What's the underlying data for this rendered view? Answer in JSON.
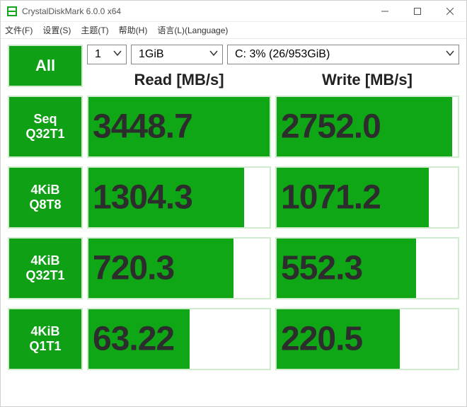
{
  "window": {
    "title": "CrystalDiskMark 6.0.0 x64"
  },
  "menu": {
    "file": "文件(F)",
    "settings": "设置(S)",
    "theme": "主题(T)",
    "help": "帮助(H)",
    "language": "语言(L)(Language)"
  },
  "controls": {
    "all_label": "All",
    "runs": "1",
    "size": "1GiB",
    "drive": "C: 3% (26/953GiB)"
  },
  "columns": {
    "read": "Read [MB/s]",
    "write": "Write [MB/s]"
  },
  "tests": [
    {
      "label1": "Seq",
      "label2": "Q32T1",
      "read": "3448.7",
      "read_fill": 100,
      "write": "2752.0",
      "write_fill": 97
    },
    {
      "label1": "4KiB",
      "label2": "Q8T8",
      "read": "1304.3",
      "read_fill": 86,
      "write": "1071.2",
      "write_fill": 84
    },
    {
      "label1": "4KiB",
      "label2": "Q32T1",
      "read": "720.3",
      "read_fill": 80,
      "write": "552.3",
      "write_fill": 77
    },
    {
      "label1": "4KiB",
      "label2": "Q1T1",
      "read": "63.22",
      "read_fill": 56,
      "write": "220.5",
      "write_fill": 68
    }
  ]
}
